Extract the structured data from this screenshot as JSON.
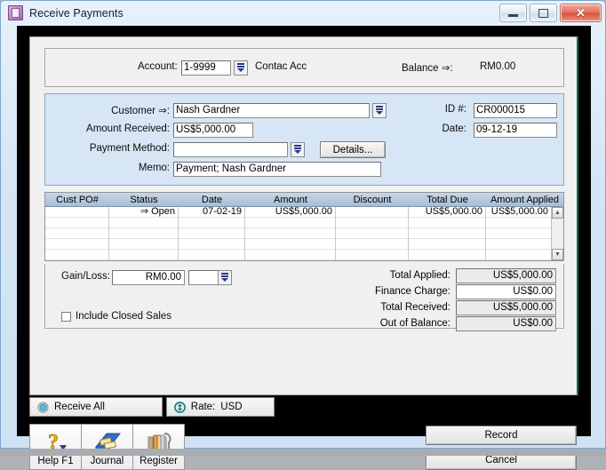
{
  "window": {
    "title": "Receive Payments",
    "icon": "app-window-icon",
    "controls": {
      "minimize": "–",
      "maximize": "□",
      "close": "✕"
    }
  },
  "account_section": {
    "account_label": "Account:",
    "account_value": "1-9999",
    "account_name": "Contac Acc",
    "balance_label": "Balance ⇒:",
    "balance_value": "RM0.00"
  },
  "customer_section": {
    "customer_label": "Customer ⇒:",
    "customer_value": "Nash Gardner",
    "amount_received_label": "Amount Received:",
    "amount_received_value": "US$5,000.00",
    "payment_method_label": "Payment Method:",
    "payment_method_value": "",
    "details_button": "Details...",
    "memo_label": "Memo:",
    "memo_value": "Payment; Nash Gardner",
    "id_label": "ID #:",
    "id_value": "CR000015",
    "date_label": "Date:",
    "date_value": "09-12-19"
  },
  "table": {
    "columns": [
      "Cust PO#",
      "Status",
      "Date",
      "Amount",
      "Discount",
      "Total Due",
      "Amount Applied"
    ],
    "rows": [
      {
        "cust_po": "",
        "status": "⇒ Open",
        "date": "07-02-19",
        "amount": "US$5,000.00",
        "discount": "",
        "total_due": "US$5,000.00",
        "amount_applied": "US$5,000.00"
      }
    ],
    "scroll_up": "▲",
    "scroll_down": "▼"
  },
  "totals_section": {
    "gain_loss_label": "Gain/Loss:",
    "gain_loss_value": "RM0.00",
    "gain_loss_currency": "",
    "include_closed_label": "Include Closed Sales",
    "include_closed_checked": false,
    "rows": [
      {
        "label": "Total Applied:",
        "value": "US$5,000.00",
        "readonly": true
      },
      {
        "label": "Finance Charge:",
        "value": "US$0.00",
        "readonly": false
      },
      {
        "label": "Total Received:",
        "value": "US$5,000.00",
        "readonly": true
      },
      {
        "label": "Out of Balance:",
        "value": "US$0.00",
        "readonly": true
      }
    ]
  },
  "action_bar": {
    "receive_all": "Receive All",
    "rate_label": "Rate:",
    "rate_value": "USD"
  },
  "toolbar": [
    {
      "label": "Help F1",
      "icon": "question-mark-icon"
    },
    {
      "label": "Journal",
      "icon": "journal-book-icon"
    },
    {
      "label": "Register",
      "icon": "card-file-icon"
    }
  ],
  "buttons": {
    "record": "Record",
    "cancel": "Cancel"
  },
  "colors": {
    "title_bar": "#d5e5f6",
    "customer_panel": "#d6e6f5",
    "table_header": "#b6c9de",
    "close_button": "#d4513c",
    "accent_teal": "#0c6b63"
  }
}
